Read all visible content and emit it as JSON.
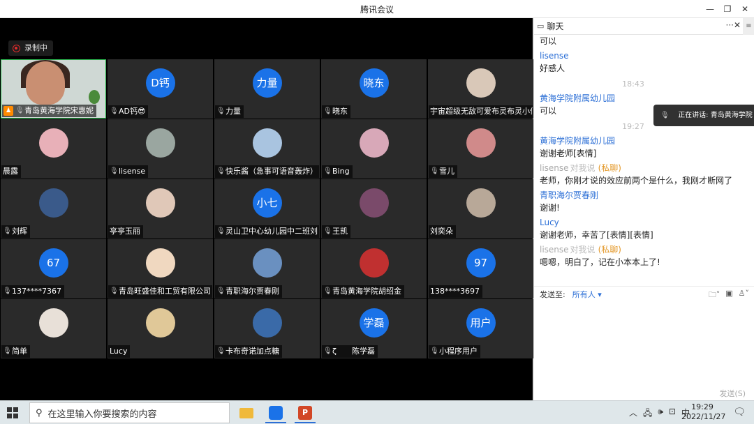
{
  "window": {
    "title": "腾讯会议",
    "minimize": "—",
    "restore": "❐",
    "close": "✕"
  },
  "recording": {
    "label": "录制中"
  },
  "participants": [
    {
      "name": "青岛黄海学院宋惠妮",
      "kind": "camera",
      "host": true
    },
    {
      "name": "AD钙😎",
      "kind": "blue",
      "avatar_text": "D钙"
    },
    {
      "name": "力量",
      "kind": "blue",
      "avatar_text": "力量"
    },
    {
      "name": "晓东",
      "kind": "blue",
      "avatar_text": "晓东"
    },
    {
      "name": "宇宙超级无敌可爱布灵布灵小仙",
      "kind": "photo",
      "color": "#d9c8b8",
      "nomic": true
    },
    {
      "name": "晨露",
      "kind": "photo",
      "color": "#e8b0b8",
      "nomic": true
    },
    {
      "name": "lisense",
      "kind": "photo",
      "color": "#9aa6a0"
    },
    {
      "name": "快乐酱（急事可语音轰炸）",
      "kind": "photo",
      "color": "#a9c4e0"
    },
    {
      "name": "Bing",
      "kind": "photo",
      "color": "#d8a8b8"
    },
    {
      "name": "雪儿",
      "kind": "photo",
      "color": "#d08a8a"
    },
    {
      "name": "刘辉",
      "kind": "photo",
      "color": "#3a5a8a"
    },
    {
      "name": "亭亭玉丽",
      "kind": "photo",
      "color": "#e0c8b8",
      "nomic": true
    },
    {
      "name": "灵山卫中心幼儿园中二班刘",
      "kind": "blue",
      "avatar_text": "小七"
    },
    {
      "name": "王凯",
      "kind": "photo",
      "color": "#7a4a6a"
    },
    {
      "name": "刘奕朵",
      "kind": "photo",
      "color": "#b8a898",
      "nomic": true
    },
    {
      "name": "137****7367",
      "kind": "blue",
      "avatar_text": "67"
    },
    {
      "name": "青岛旺盛佳和工贸有限公司",
      "kind": "photo",
      "color": "#f0d8c0"
    },
    {
      "name": "青职海尔贾春刚",
      "kind": "photo",
      "color": "#6a90c0"
    },
    {
      "name": "青岛黄海学院胡绍金",
      "kind": "photo",
      "color": "#c03030"
    },
    {
      "name": "138****3697",
      "kind": "blue",
      "avatar_text": "97",
      "nomic": true
    },
    {
      "name": "简单",
      "kind": "photo",
      "color": "#e8e0d8"
    },
    {
      "name": "Lucy",
      "kind": "photo",
      "color": "#e0c898",
      "nomic": true
    },
    {
      "name": "卡布奇诺加点糖",
      "kind": "photo",
      "color": "#3a6aa8"
    },
    {
      "name": "ζ　　陈学磊",
      "kind": "blue",
      "avatar_text": "学磊"
    },
    {
      "name": "小程序用户",
      "kind": "blue",
      "avatar_text": "用户"
    }
  ],
  "chat": {
    "title": "聊天",
    "more": "···",
    "close": "✕",
    "menu": "≡",
    "messages": [
      {
        "type": "text",
        "text": "可以"
      },
      {
        "type": "sender",
        "name": "lisense"
      },
      {
        "type": "text",
        "text": "好感人"
      },
      {
        "type": "time",
        "text": "18:43"
      },
      {
        "type": "sender",
        "name": "黄海学院附属幼儿园"
      },
      {
        "type": "text",
        "text": "可以"
      },
      {
        "type": "time",
        "text": "19:27"
      },
      {
        "type": "sender",
        "name": "黄海学院附属幼儿园"
      },
      {
        "type": "text",
        "text": "谢谢老师[表情]"
      },
      {
        "type": "private",
        "name": "lisense",
        "dir": "对我说",
        "priv": "(私聊)"
      },
      {
        "type": "text",
        "text": "老师，你刚才说的效应前两个是什么，我刚才断网了"
      },
      {
        "type": "sender",
        "name": "青职海尔贾春刚"
      },
      {
        "type": "text",
        "text": "谢谢!"
      },
      {
        "type": "sender",
        "name": "Lucy"
      },
      {
        "type": "text",
        "text": "谢谢老师，幸苦了[表情][表情]"
      },
      {
        "type": "private",
        "name": "lisense",
        "dir": "对我说",
        "priv": "(私聊)"
      },
      {
        "type": "text",
        "text": "嗯嗯，明白了，记在小本本上了!"
      }
    ],
    "speaking": "正在讲话: 青岛黄海学院",
    "send_to_label": "发送至:",
    "send_to_target": "所有人 ▾",
    "send_button": "发送(S)"
  },
  "taskbar": {
    "search_placeholder": "在这里输入你要搜索的内容",
    "tray": [
      "︿",
      "🖧",
      "🕪",
      "⊡",
      "中"
    ],
    "time": "19:29",
    "date": "2022/11/27"
  }
}
